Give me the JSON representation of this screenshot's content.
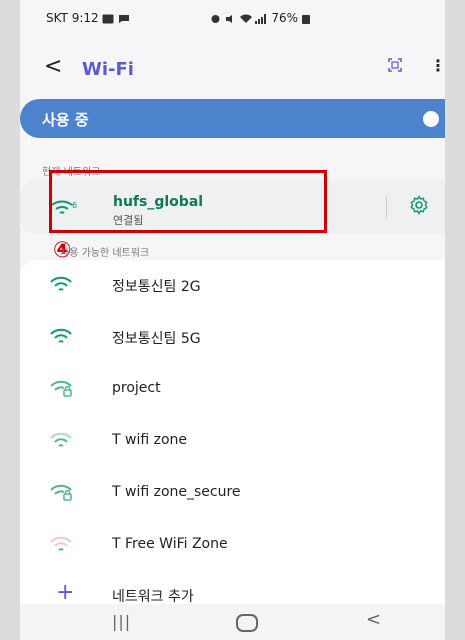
{
  "status_bar": {
    "time": "SKT 9:12",
    "battery": "76%"
  },
  "header": {
    "back_label": "<",
    "title": "Wi-Fi",
    "more_label": "⋮"
  },
  "wifi_toggle": {
    "label": "사용 중",
    "state": "on"
  },
  "current_network": {
    "section_label": "현재 네트워크",
    "name": "hufs_global",
    "status": "연결됨"
  },
  "annotation": {
    "marker": "④",
    "color": "#d00000"
  },
  "available": {
    "section_label": "사용 가능한 네트워크",
    "networks": [
      {
        "name": "정보통신팀 2G",
        "secured": false
      },
      {
        "name": "정보통신팀 5G",
        "secured": false
      },
      {
        "name": "project",
        "secured": true
      },
      {
        "name": "T wifi zone",
        "secured": false
      },
      {
        "name": "T wifi zone_secure",
        "secured": true
      },
      {
        "name": "T Free WiFi Zone",
        "secured": false
      }
    ]
  },
  "add_network": {
    "plus": "+",
    "label": "네트워크 추가"
  },
  "nav_bar": {
    "recents": "|||",
    "back": "<"
  },
  "colors": {
    "accent": "#5b5bd6",
    "toggle_bar": "#4d82cc",
    "wifi_green": "#0d9b6a",
    "connected_text": "#0d7a52"
  }
}
